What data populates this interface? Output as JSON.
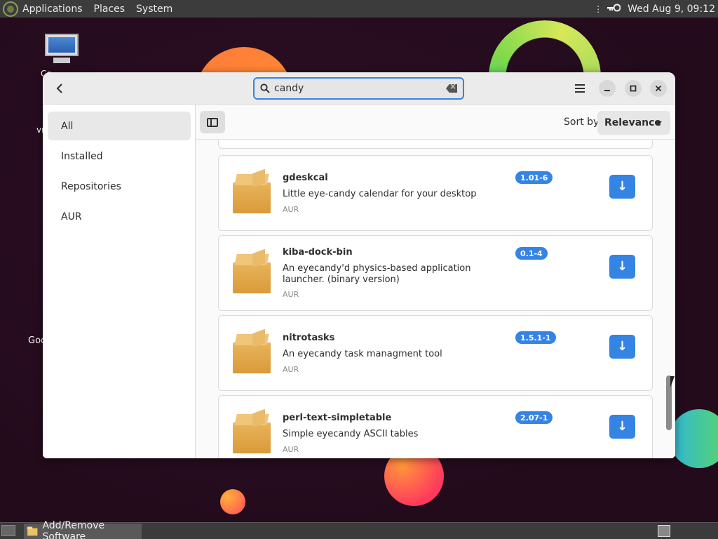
{
  "top_panel": {
    "menus": [
      "Applications",
      "Places",
      "System"
    ],
    "clock": "Wed Aug  9, 09:12",
    "tray_icon": "network-key-icon"
  },
  "desktop": {
    "icon_label_computer": "Co",
    "label_vm": "vn",
    "label_goo": "Goo"
  },
  "window": {
    "search": {
      "value": "candy",
      "placeholder": ""
    },
    "sidebar": {
      "items": [
        {
          "label": "All",
          "active": true
        },
        {
          "label": "Installed",
          "active": false
        },
        {
          "label": "Repositories",
          "active": false
        },
        {
          "label": "AUR",
          "active": false
        }
      ]
    },
    "toolbar": {
      "sort_label": "Sort by",
      "sort_value": "Relevance"
    },
    "packages": [
      {
        "name": "gdeskcal",
        "description": "Little eye-candy calendar for your desktop",
        "repo": "AUR",
        "version": "1.01-6"
      },
      {
        "name": "kiba-dock-bin",
        "description": "An eyecandy'd physics-based application launcher. (binary version)",
        "repo": "AUR",
        "version": "0.1-4"
      },
      {
        "name": "nitrotasks",
        "description": "An eyecandy task managment tool",
        "repo": "AUR",
        "version": "1.5.1-1"
      },
      {
        "name": "perl-text-simpletable",
        "description": "Simple eyecandy ASCII tables",
        "repo": "AUR",
        "version": "2.07-1"
      }
    ],
    "scroll_position": 0.75
  },
  "taskbar": {
    "task_label": "Add/Remove Software"
  },
  "colors": {
    "accent": "#3584e4",
    "panel": "#3c3c3c"
  }
}
